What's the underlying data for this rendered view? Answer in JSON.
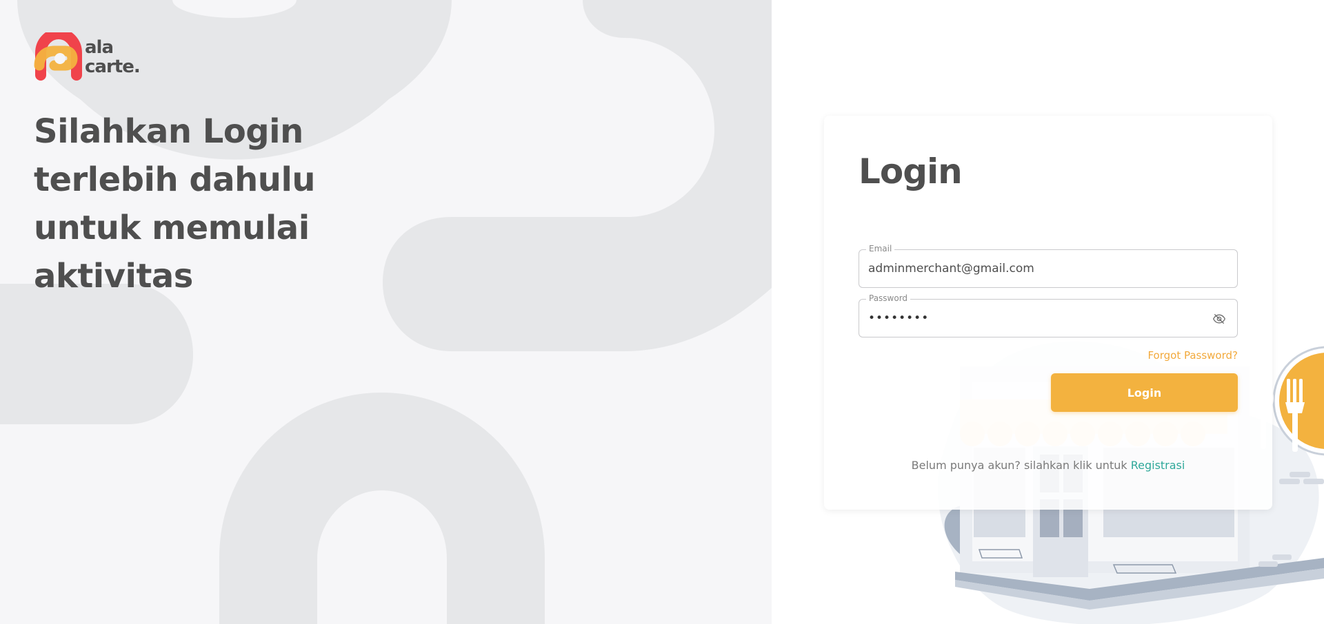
{
  "brand": {
    "name_line1": "ala",
    "name_line2": "carte.",
    "colors": {
      "primary_red": "#f0434b",
      "accent_orange": "#f3b23f",
      "link_teal": "#2fa89a",
      "text_dark": "#4f4f4f"
    }
  },
  "hero": {
    "lines": [
      "Silahkan Login",
      "terlebih dahulu",
      "untuk memulai",
      "aktivitas"
    ]
  },
  "login_form": {
    "title": "Login",
    "email": {
      "label": "Email",
      "value": "adminmerchant@gmail.com"
    },
    "password": {
      "label": "Password",
      "masked_value": "••••••••",
      "toggle_icon": "eye-off-icon"
    },
    "forgot_password": "Forgot Password?",
    "submit_label": "Login",
    "register_prompt": "Belum punya akun? silahkan klik untuk",
    "register_link": "Registrasi"
  },
  "icons": {
    "logo": "ala-carte-logo-icon",
    "restaurant": "spoon-fork-icon"
  }
}
